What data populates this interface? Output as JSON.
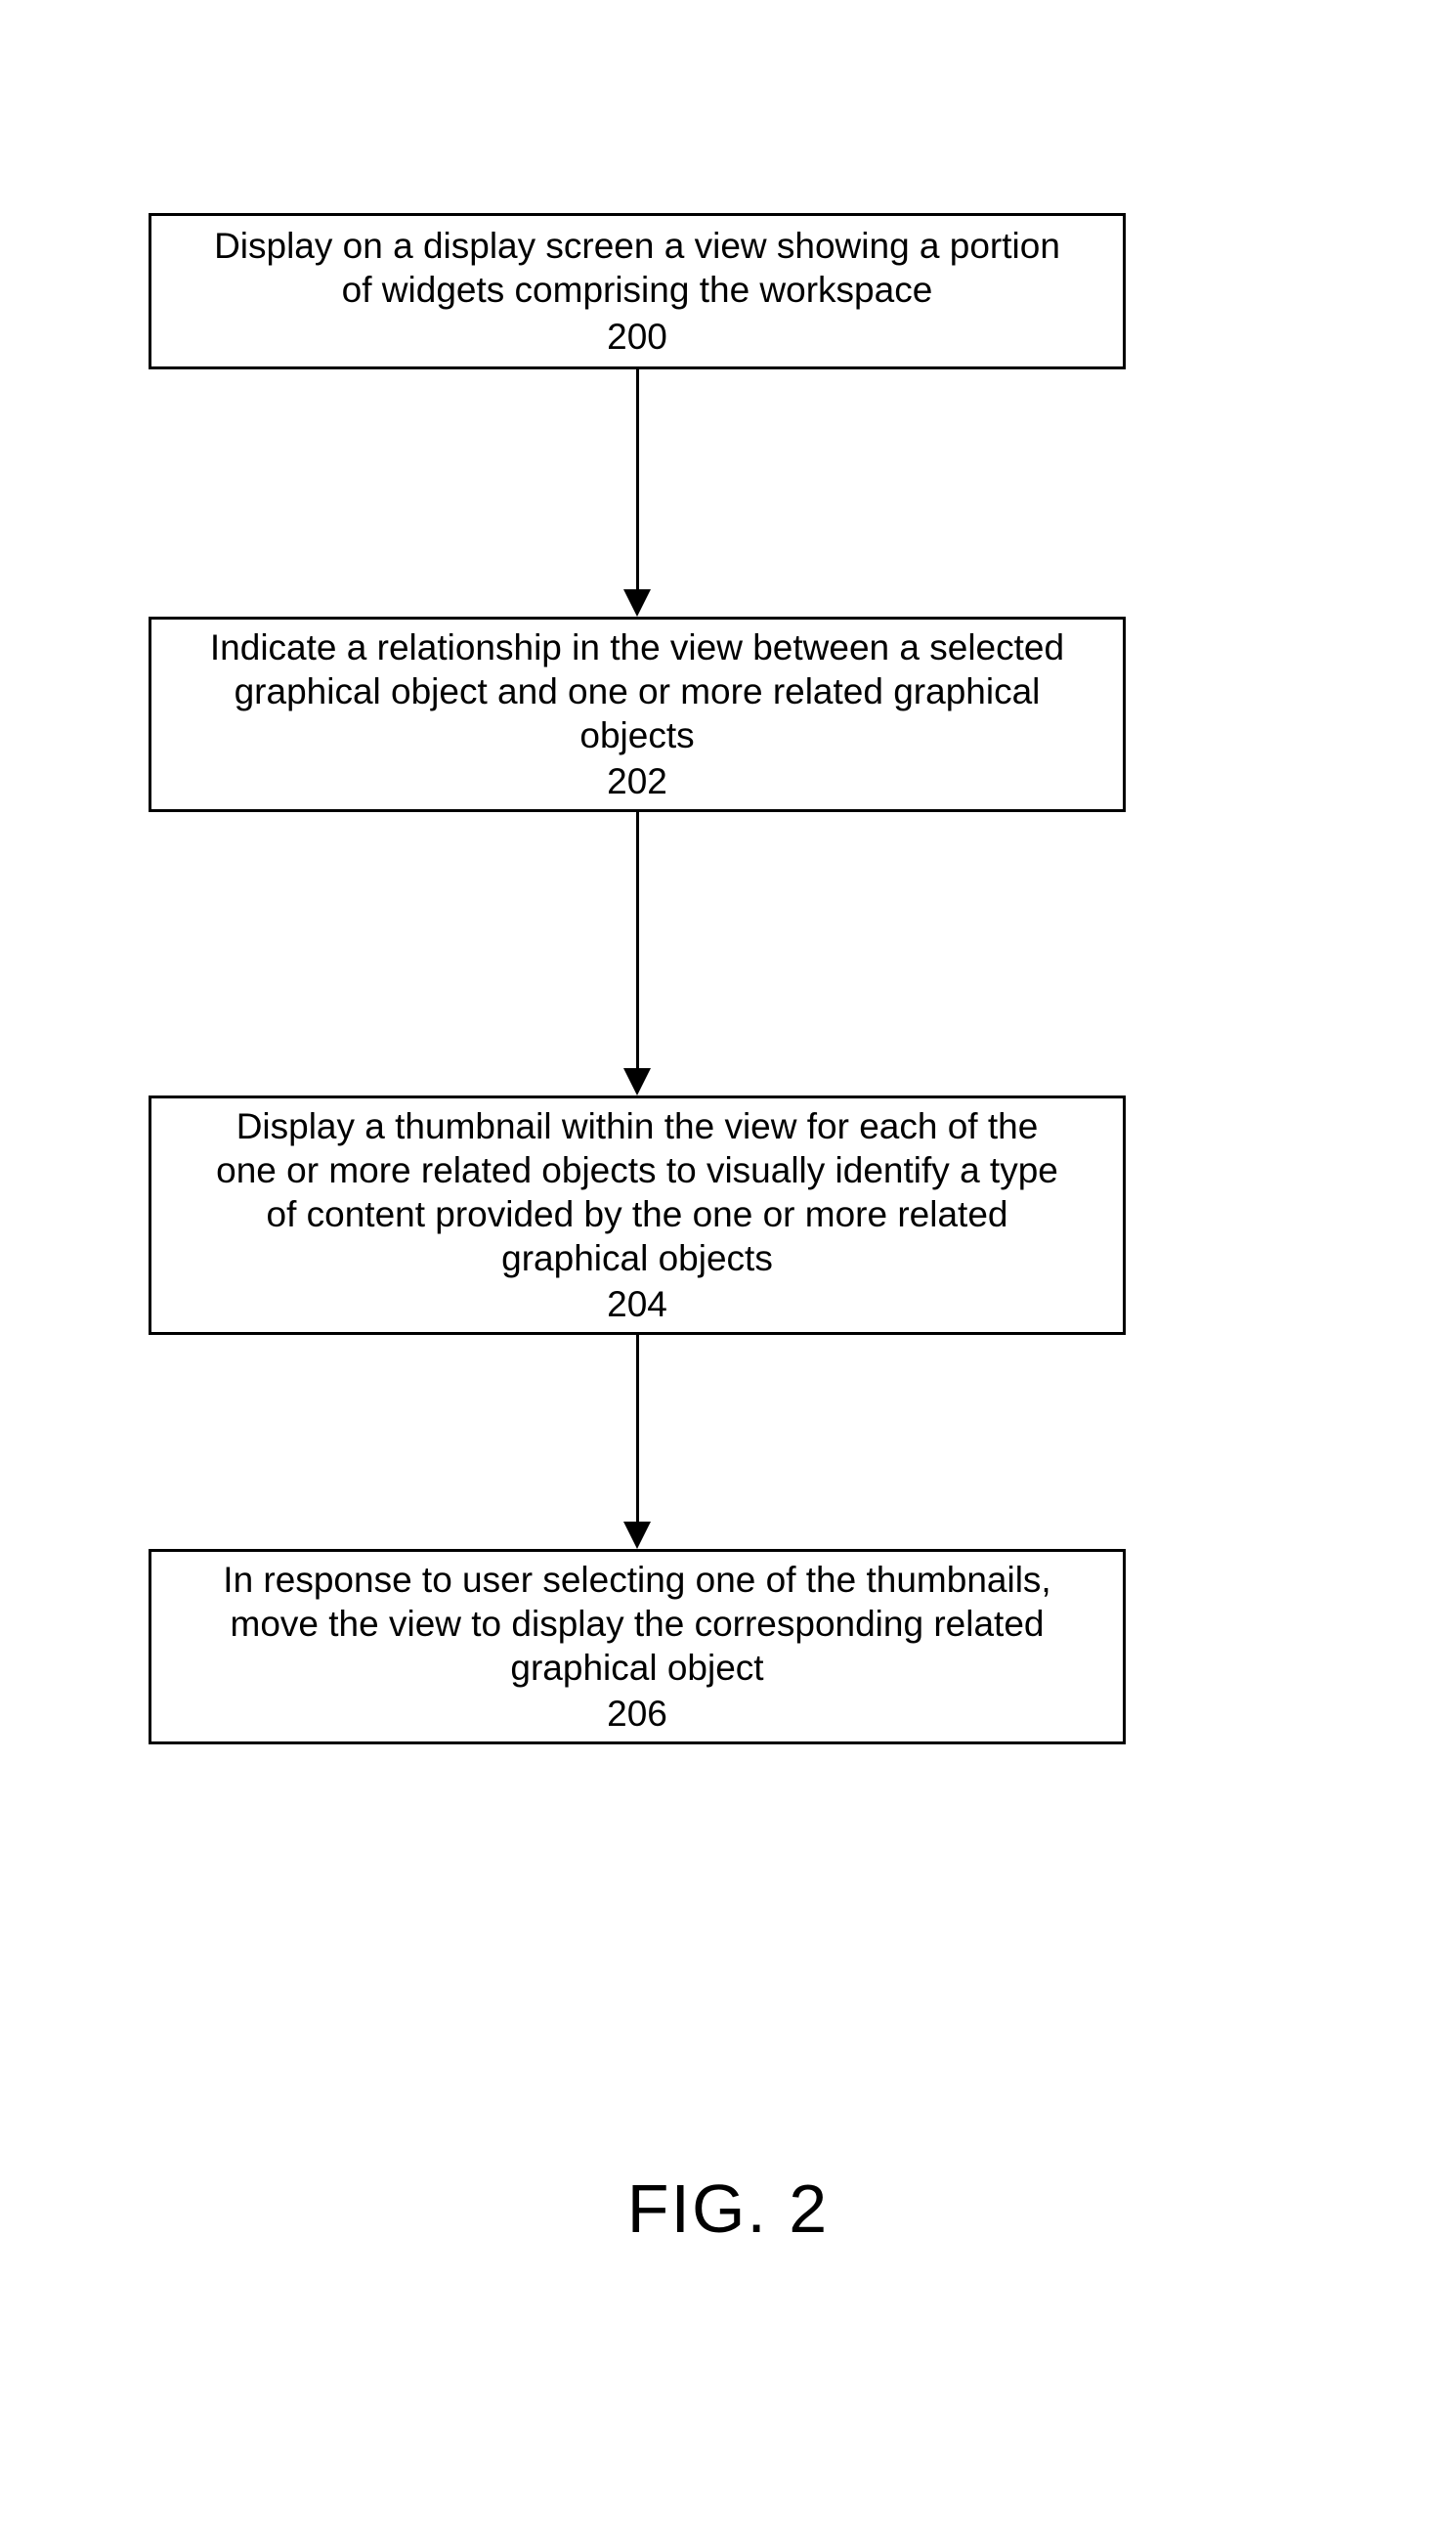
{
  "diagram": {
    "boxes": [
      {
        "text": "Display on a display screen a view showing a portion\nof widgets comprising the workspace",
        "ref": "200"
      },
      {
        "text": "Indicate a relationship in the view between a selected\ngraphical object and one or more related graphical\nobjects",
        "ref": "202"
      },
      {
        "text": "Display a thumbnail within the view for each of the\none or more related objects to visually identify a type\nof content provided by the one or more related\ngraphical objects",
        "ref": "204"
      },
      {
        "text": "In response to user selecting one of the thumbnails,\nmove the view to display the corresponding related\ngraphical object",
        "ref": "206"
      }
    ],
    "figure_label": "FIG. 2"
  }
}
